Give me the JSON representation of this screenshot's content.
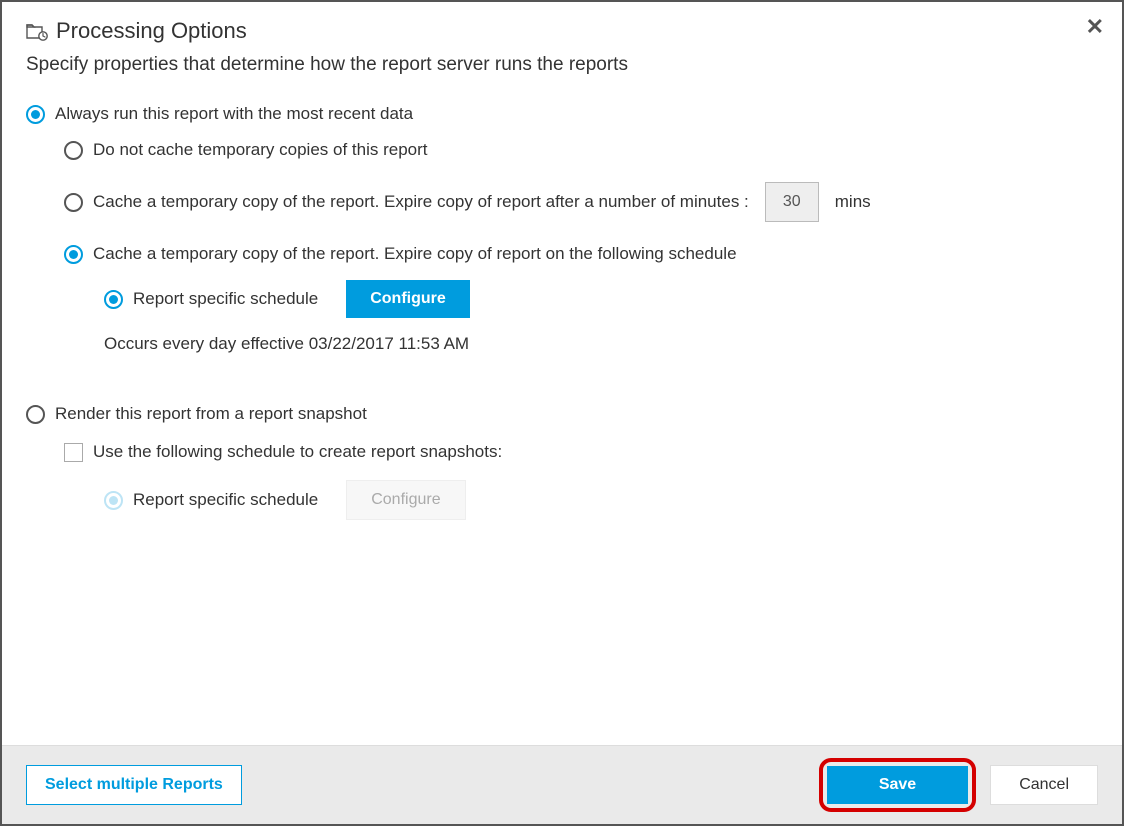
{
  "header": {
    "title": "Processing Options",
    "close": "✕"
  },
  "subtitle": "Specify properties that determine how the report server runs the reports",
  "options": {
    "run_recent": "Always run this report with the most recent data",
    "no_cache": "Do not cache temporary copies of this report",
    "cache_minutes_pre": "Cache a temporary copy of the report. Expire copy of report after a number of minutes :",
    "cache_minutes_value": "30",
    "cache_minutes_unit": "mins",
    "cache_schedule": "Cache a temporary copy of the report. Expire copy of report on the following schedule",
    "report_specific": "Report specific schedule",
    "configure": "Configure",
    "schedule_desc": "Occurs every day effective 03/22/2017 11:53 AM",
    "render_snapshot": "Render this report from a report snapshot",
    "use_schedule_snapshot": "Use the following schedule to create report snapshots:",
    "report_specific2": "Report specific schedule",
    "configure2": "Configure"
  },
  "footer": {
    "select_multiple": "Select multiple Reports",
    "save": "Save",
    "cancel": "Cancel"
  }
}
